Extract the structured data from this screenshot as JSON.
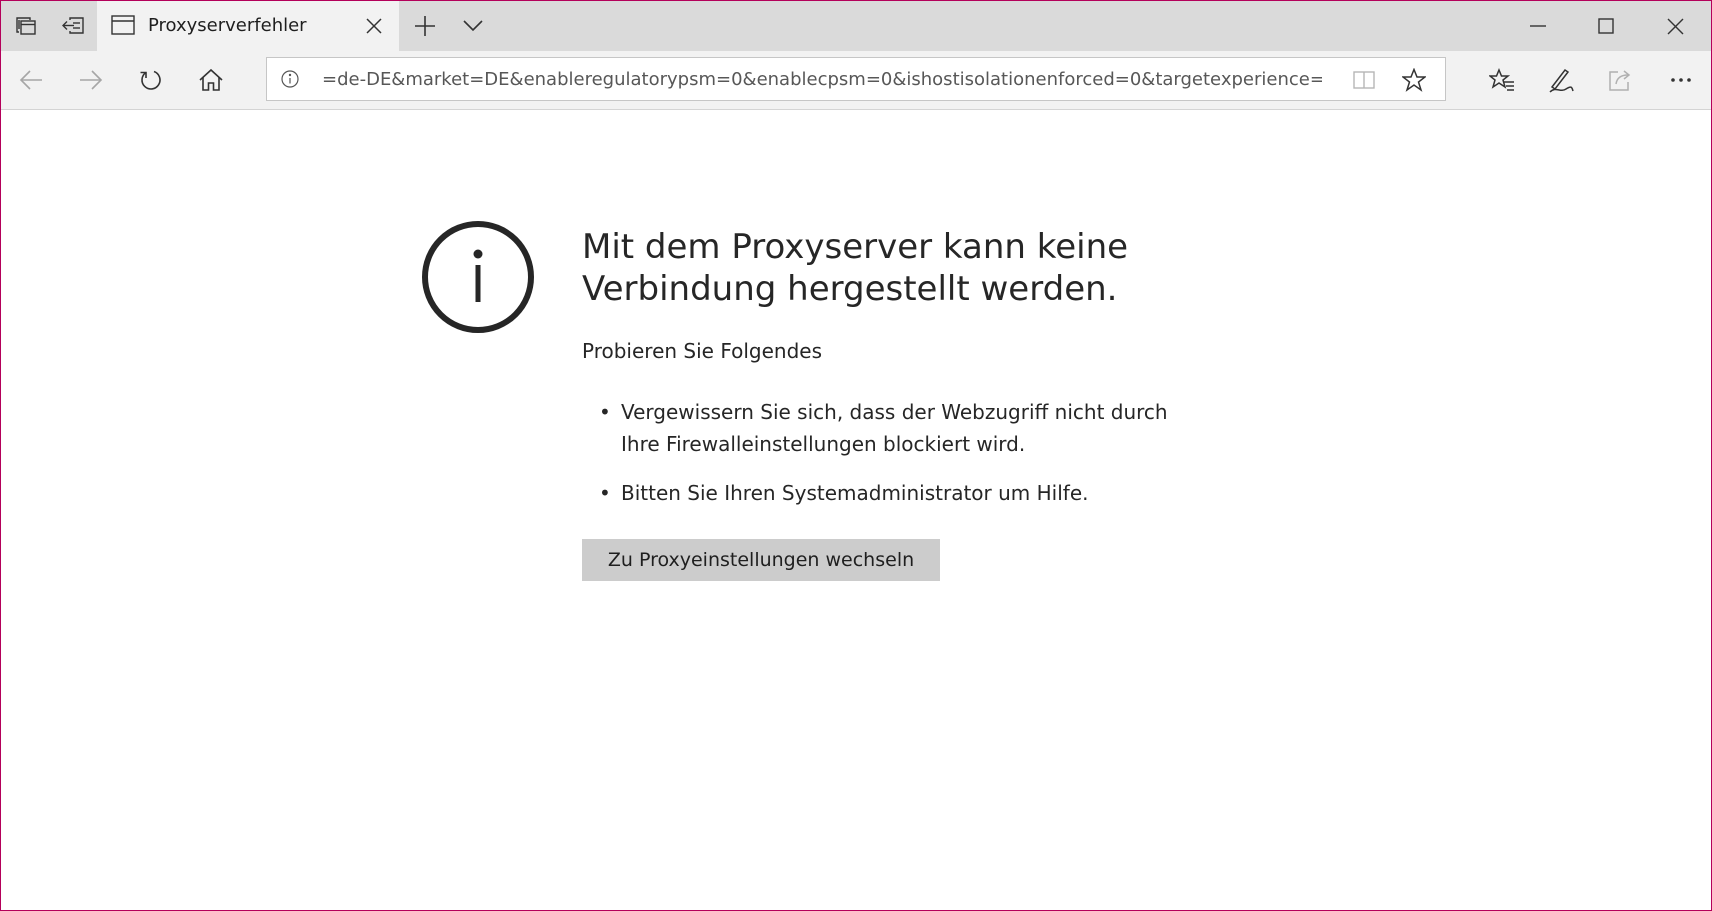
{
  "browser": {
    "tab": {
      "title": "Proxyserverfehler"
    },
    "address_bar": {
      "url": "=de-DE&market=DE&enableregulatorypsm=0&enablecpsm=0&ishostisolationenforced=0&targetexperience=default"
    },
    "icons": {
      "tab_manager": "tab-manager-icon",
      "set_aside": "set-aside-tabs-icon",
      "new_tab": "plus-icon",
      "tab_list": "chevron-down-icon",
      "minimize": "minimize-icon",
      "maximize": "maximize-icon",
      "close": "close-icon",
      "back": "back-arrow-icon",
      "forward": "forward-arrow-icon",
      "refresh": "refresh-icon",
      "home": "home-icon",
      "info": "info-icon",
      "reading_view": "book-icon",
      "favorite": "star-icon",
      "favorites_hub": "favorites-list-icon",
      "notes": "pen-icon",
      "share": "share-icon",
      "more": "ellipsis-icon"
    },
    "colors": {
      "window_border": "#b4005a",
      "titlebar": "#dadada",
      "toolbar": "#f2f2f2",
      "button": "#cccccc"
    }
  },
  "error_page": {
    "icon": "info-circle-icon",
    "heading": "Mit dem Proxyserver kann keine Verbindung hergestellt werden.",
    "subheading": "Probieren Sie Folgendes",
    "tips": [
      "Vergewissern Sie sich, dass der Webzugriff nicht durch Ihre Firewalleinstellungen blockiert wird.",
      "Bitten Sie Ihren Systemadministrator um Hilfe."
    ],
    "button_label": "Zu Proxyeinstellungen wechseln"
  }
}
